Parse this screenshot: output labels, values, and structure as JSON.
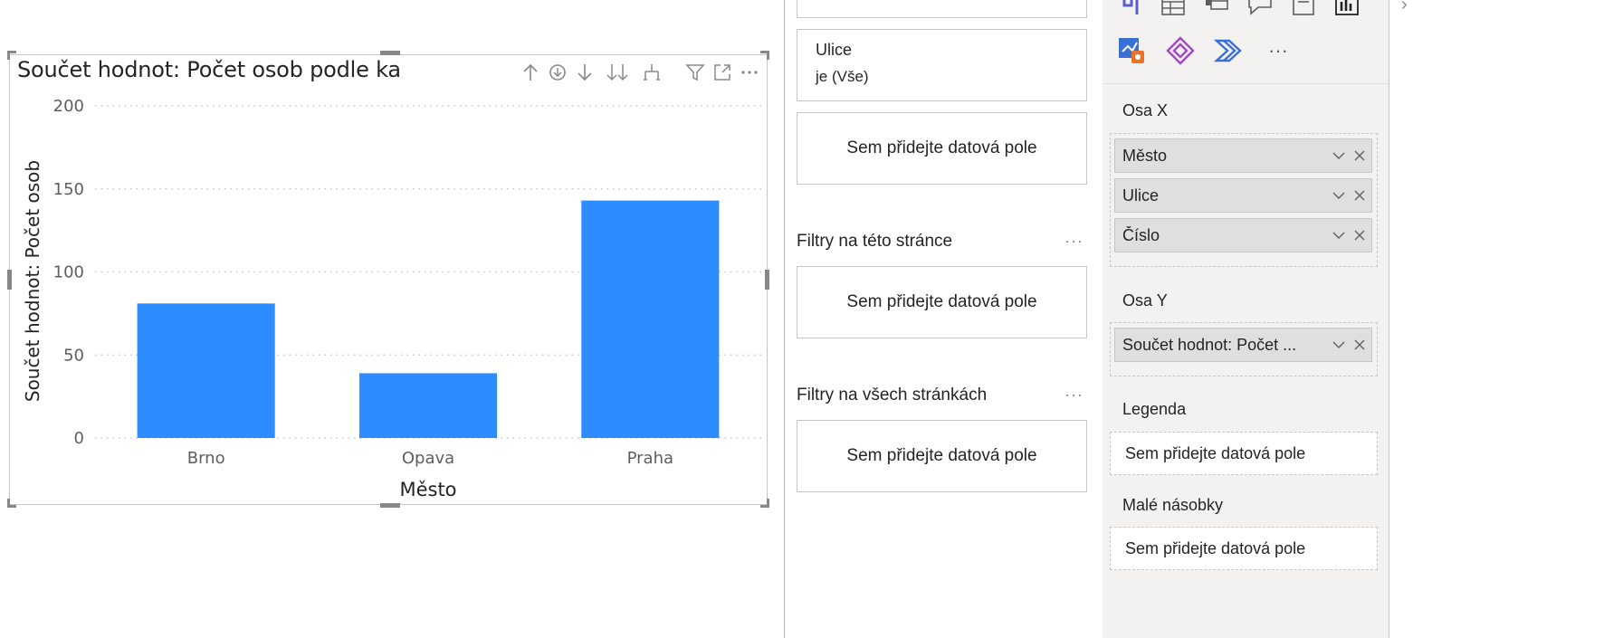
{
  "visual": {
    "title": "Součet hodnot: Počet osob podle ka",
    "header_icons": [
      "arrow-up-icon",
      "drill-mode-icon",
      "arrow-down-icon",
      "expand-all-down-icon",
      "expand-hierarchy-icon",
      "filter-icon",
      "focus-mode-icon",
      "more-options-icon"
    ]
  },
  "chart_data": {
    "type": "bar",
    "categories": [
      "Brno",
      "Opava",
      "Praha"
    ],
    "values": [
      81,
      39,
      143
    ],
    "title": "Součet hodnot: Počet osob podle ka",
    "xlabel": "Město",
    "ylabel": "Součet hodnot: Počet osob",
    "ylim": [
      0,
      200
    ],
    "yticks": [
      "0",
      "50",
      "100",
      "150",
      "200"
    ],
    "grid": true,
    "bar_color": "#2d8cff"
  },
  "filters": {
    "ulice_title": "Ulice",
    "ulice_value": "je (Vše)",
    "visual_drop": "Sem přidejte datová pole",
    "page_section": "Filtry na této stránce",
    "page_drop": "Sem přidejte datová pole",
    "all_section": "Filtry na všech stránkách",
    "all_drop": "Sem přidejte datová pole",
    "more": "···"
  },
  "viz_pane": {
    "icons": [
      "ribbon-chart-icon",
      "table-icon",
      "matrix-icon",
      "qa-icon",
      "paginated-icon",
      "bar-card-icon",
      "power-apps-icon",
      "power-automate-icon",
      "more-visuals-icon"
    ],
    "more_visuals": "···",
    "osa_x_label": "Osa X",
    "osa_x_fields": [
      "Město",
      "Ulice",
      "Číslo"
    ],
    "osa_y_label": "Osa Y",
    "osa_y_fields": [
      "Součet hodnot: Počet ..."
    ],
    "legend_label": "Legenda",
    "legend_drop": "Sem přidejte datová pole",
    "small_multiples_label": "Malé násobky",
    "small_multiples_drop": "Sem přidejte datová pole"
  }
}
